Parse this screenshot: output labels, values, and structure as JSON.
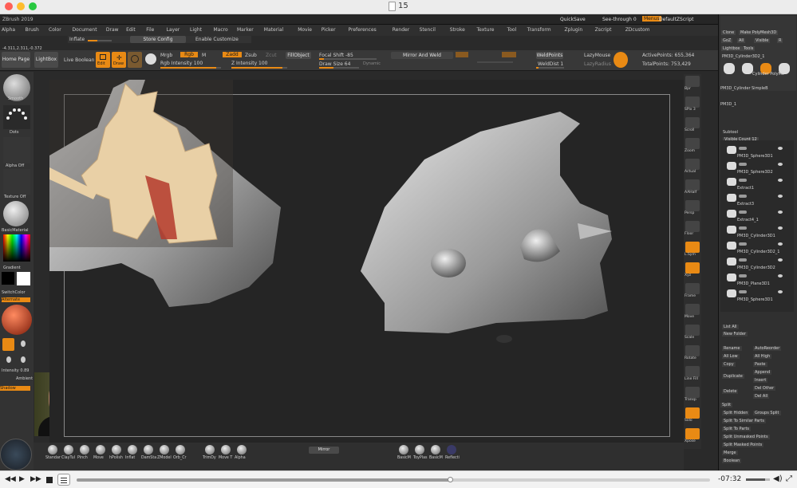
{
  "window": {
    "title": "15"
  },
  "app": {
    "title": "ZBrush 2019",
    "menu": [
      "Alpha",
      "Brush",
      "Color",
      "Document",
      "Draw",
      "Edit",
      "File",
      "Layer",
      "Light",
      "Macro",
      "Marker",
      "Material",
      "Movie",
      "Picker",
      "Preferences",
      "Render",
      "Stencil",
      "Stroke",
      "Texture",
      "Tool",
      "Transform",
      "Zplugin",
      "Zscript",
      "ZDcustom"
    ],
    "quicksave": "QuickSave",
    "seethrough": "See-through 0",
    "menus": "Menus",
    "defaultzscript": "DefaultZScript",
    "coords": "-4.311,2.311,-0.372",
    "inflate": "Inflate",
    "store_config": "Store Config",
    "enable_customize": "Enable Customize"
  },
  "toolbar": {
    "home": "Home Page",
    "lightbox": "LightBox",
    "live_boolean": "Live Boolean",
    "edit": "Edit",
    "draw": "Draw",
    "mrgb": "Mrgb",
    "rgb": "Rgb",
    "m": "M",
    "rgb_intensity": "Rgb Intensity 100",
    "zadd": "Zadd",
    "zsub": "Zsub",
    "zcut": "Zcut",
    "z_intensity": "Z Intensity 100",
    "fill_object": "FillObject",
    "focal_shift": "Focal Shift -85",
    "draw_size": "Draw Size 64",
    "dynamic": "Dynamic",
    "mirror_weld": "Mirror And Weld",
    "weld_points": "WeldPoints",
    "weld_dist": "WeldDist 1",
    "lazymouse": "LazyMouse",
    "lazyradius": "LazyRadius",
    "active_points": "ActivePoints: 655,364",
    "total_points": "TotalPoints: 753,429"
  },
  "left_tray": {
    "smooth": "Smooth",
    "dots": "Dots",
    "alpha_off": "Alpha Off",
    "texture_off": "Texture Off",
    "material": "BasicMaterial",
    "gradient": "Gradient",
    "switch_color": "SwitchColor",
    "alternate": "Alternate",
    "intensity": "Intensity 0.89",
    "ambient": "Ambient",
    "shadow": "Shadow",
    "colors": {
      "fg": "#000000",
      "bg": "#ffffff"
    }
  },
  "right_shelf": [
    "Bpr",
    "SPix 3",
    "Scroll",
    "Zoom",
    "Actual",
    "AAHalf",
    "Persp",
    "Floor",
    "L.Sym",
    "Xyz",
    "Frame",
    "Move",
    "Scale",
    "Rotate",
    "Line Fill",
    "Transp",
    "Solo",
    "Xpose"
  ],
  "subtool_panel": {
    "top_buttons": [
      "Clone",
      "Make PolyMesh3D",
      "GoZ",
      "All",
      "Visible",
      "R",
      "Lightbox",
      "Tools"
    ],
    "current_tool": "PM3D_Cylinder3D2_1",
    "tool_thumbs": [
      "Cylinder PolyMe",
      "SimpleB",
      "PM3D_1",
      "PM3D_Cylinder"
    ],
    "header": "Subtool",
    "visible_count": "Visible Count 12",
    "items": [
      "PM3D_Sphere3D1",
      "PM3D_Sphere3D2",
      "Extract1",
      "Extract3",
      "Extract4_1",
      "PM3D_Cylinder3D1",
      "PM3D_Cylinder3D2_1",
      "PM3D_Cylinder3D2",
      "PM3D_Plane3D1",
      "PM3D_Sphere3D1"
    ],
    "list_all": "List All",
    "new_folder": "New Folder",
    "rename": "Rename",
    "autoreorder": "AutoReorder",
    "all_low": "All Low",
    "all_high": "All High",
    "copy": "Copy",
    "paste": "Paste",
    "duplicate": "Duplicate",
    "append": "Append",
    "insert": "Insert",
    "delete": "Delete",
    "del_other": "Del Other",
    "del_all": "Del All",
    "split": "Split",
    "split_hidden": "Split Hidden",
    "groups_split": "Groups Split",
    "split_similar": "Split To Similar Parts",
    "split_parts": "Split To Parts",
    "split_unmasked": "Split Unmasked Points",
    "split_masked": "Split Masked Points",
    "merge": "Merge",
    "boolean": "Boolean"
  },
  "bottom_shelf": {
    "brushes": [
      "Standar",
      "ClayTul",
      "Pinch",
      "Move",
      "hPolish",
      "Inflat",
      "DamSta",
      "ZModel",
      "Orb_Cr",
      "TrimDy",
      "Move T",
      "Alpha"
    ],
    "mirror": "Mirror",
    "materials": [
      "BasicM",
      "ToyPlas",
      "BasicM",
      "Reflecti"
    ]
  },
  "player": {
    "time": "-07:32",
    "progress": 0.59,
    "volume": 0.8
  }
}
